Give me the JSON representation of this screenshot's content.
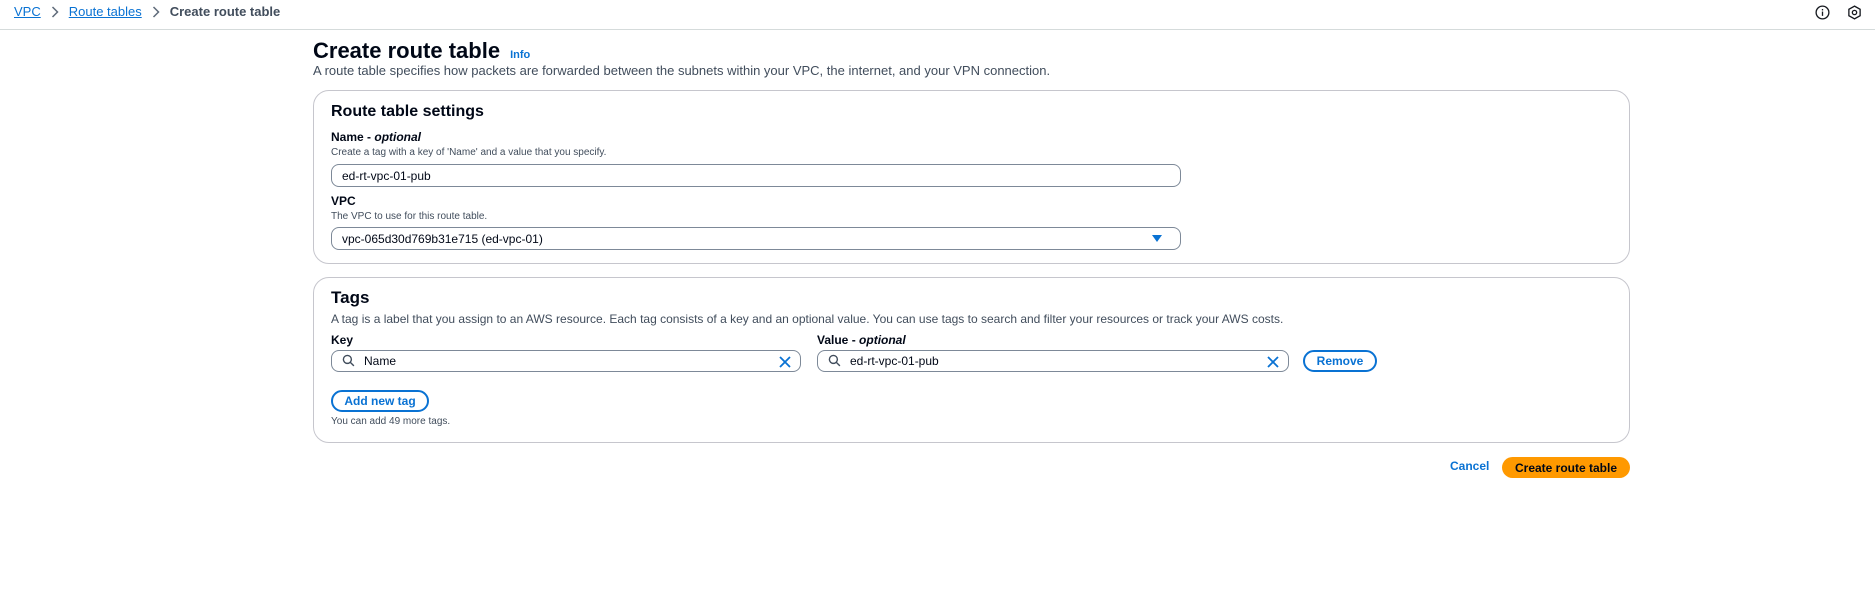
{
  "breadcrumb": {
    "items": [
      {
        "label": "VPC"
      },
      {
        "label": "Route tables"
      }
    ],
    "current": "Create route table"
  },
  "top_icons": [
    "info-circle-icon",
    "settings-hexagon-icon"
  ],
  "header": {
    "title": "Create route table",
    "info_label": "Info",
    "description": "A route table specifies how packets are forwarded between the subnets within your VPC, the internet, and your VPN connection."
  },
  "settings": {
    "title": "Route table settings",
    "name": {
      "label": "Name -",
      "label_optional": "optional",
      "description": "Create a tag with a key of 'Name' and a value that you specify.",
      "value": "ed-rt-vpc-01-pub"
    },
    "vpc": {
      "label": "VPC",
      "description": "The VPC to use for this route table.",
      "selected": "vpc-065d30d769b31e715 (ed-vpc-01)"
    }
  },
  "tags": {
    "title": "Tags",
    "description": "A tag is a label that you assign to an AWS resource. Each tag consists of a key and an optional value. You can use tags to search and filter your resources or track your AWS costs.",
    "key_label": "Key",
    "value_label": "Value -",
    "value_label_optional": "optional",
    "rows": [
      {
        "key": "Name",
        "value": "ed-rt-vpc-01-pub",
        "remove_label": "Remove"
      }
    ],
    "add_label": "Add new tag",
    "hint": "You can add 49 more tags."
  },
  "actions": {
    "cancel_label": "Cancel",
    "submit_label": "Create route table"
  },
  "colors": {
    "link": "#0972d3",
    "primary": "#ff9900",
    "border": "#c6c6cd",
    "text": "#000716"
  }
}
